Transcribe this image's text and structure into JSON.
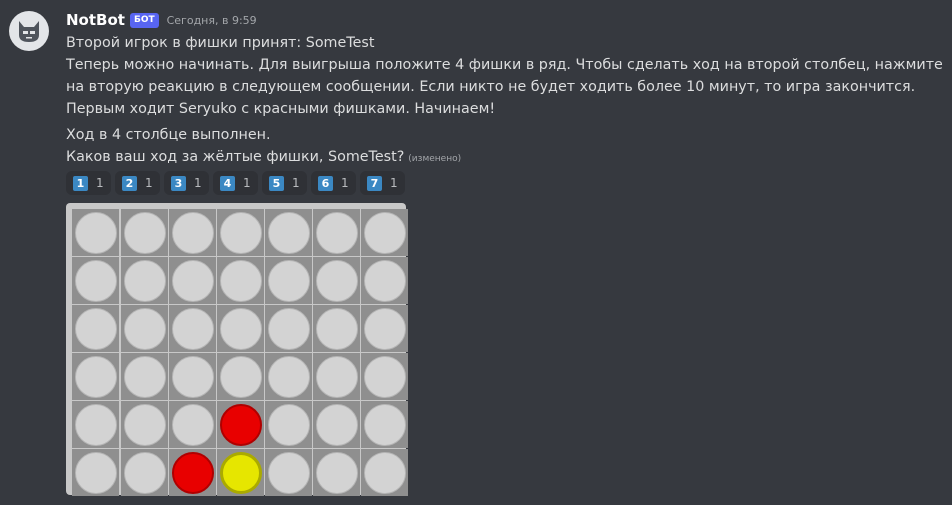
{
  "message": {
    "author": "NotBot",
    "bot_tag": "БОТ",
    "timestamp": "Сегодня, в 9:59",
    "lines": [
      "Второй игрок в фишки принят: SomeTest",
      "Теперь можно начинать. Для выигрыша положите 4 фишки в ряд. Чтобы сделать ход на второй столбец, нажмите на вторую реакцию в следующем сообщении. Если никто не будет ходить более 10 минут, то игра закончится. Первым ходит Seryuko с красными фишками. Начинаем!"
    ],
    "followup": [
      "Ход в 4 столбце выполнен.",
      "Каков ваш ход за жёлтые фишки, SomeTest?"
    ],
    "edited_label": "(изменено)"
  },
  "reactions": [
    {
      "emoji": "1",
      "count": "1"
    },
    {
      "emoji": "2",
      "count": "1"
    },
    {
      "emoji": "3",
      "count": "1"
    },
    {
      "emoji": "4",
      "count": "1"
    },
    {
      "emoji": "5",
      "count": "1"
    },
    {
      "emoji": "6",
      "count": "1"
    },
    {
      "emoji": "7",
      "count": "1"
    }
  ],
  "board": {
    "rows": [
      [
        "empty",
        "empty",
        "empty",
        "empty",
        "empty",
        "empty",
        "empty"
      ],
      [
        "empty",
        "empty",
        "empty",
        "empty",
        "empty",
        "empty",
        "empty"
      ],
      [
        "empty",
        "empty",
        "empty",
        "empty",
        "empty",
        "empty",
        "empty"
      ],
      [
        "empty",
        "empty",
        "empty",
        "empty",
        "empty",
        "empty",
        "empty"
      ],
      [
        "empty",
        "empty",
        "empty",
        "red",
        "empty",
        "empty",
        "empty"
      ],
      [
        "empty",
        "empty",
        "red",
        "yellow",
        "empty",
        "empty",
        "empty"
      ]
    ]
  },
  "colors": {
    "background": "#36393f",
    "bot_tag": "#5865f2",
    "keycap": "#3b88c3",
    "red_disc": "#e80000",
    "yellow_disc": "#e6e600"
  }
}
